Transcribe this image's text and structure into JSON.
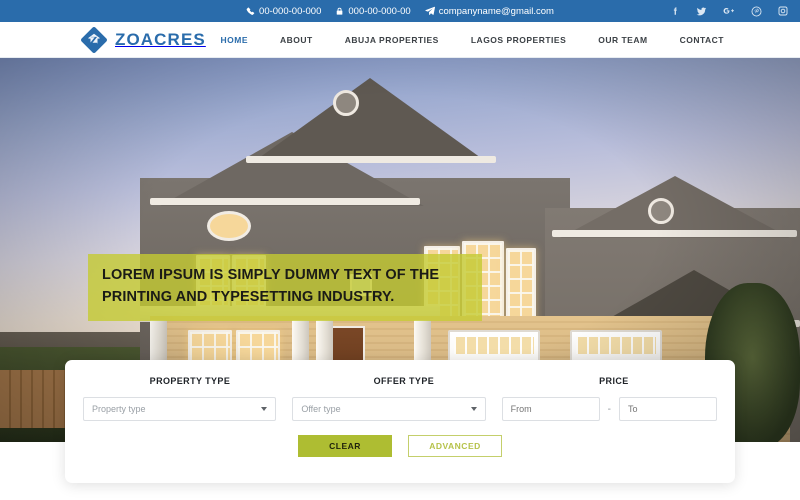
{
  "topbar": {
    "phone": "00-000-00-000",
    "fax": "000-00-000-00",
    "email": "companyname@gmail.com",
    "phone_icon": "phone-icon",
    "fax_icon": "lock-icon",
    "email_icon": "send-icon",
    "background_color": "#2a6cab",
    "social": [
      {
        "name": "facebook",
        "label": "f"
      },
      {
        "name": "twitter",
        "label": "t"
      },
      {
        "name": "google-plus",
        "label": "G+"
      },
      {
        "name": "pinterest",
        "label": "P"
      },
      {
        "name": "instagram",
        "label": "I"
      }
    ]
  },
  "header": {
    "brand": "ZOACRES",
    "brand_color": "#2a6cab",
    "nav": [
      {
        "label": "HOME",
        "active": true
      },
      {
        "label": "ABOUT",
        "active": false
      },
      {
        "label": "ABUJA PROPERTIES",
        "active": false
      },
      {
        "label": "LAGOS PROPERTIES",
        "active": false
      },
      {
        "label": "OUR TEAM",
        "active": false
      },
      {
        "label": "CONTACT",
        "active": false
      }
    ]
  },
  "hero": {
    "headline": "LOREM IPSUM IS SIMPLY DUMMY TEXT OF THE PRINTING AND TYPESETTING INDUSTRY.",
    "band_color": "#c4ca32",
    "image_description": "Two-story suburban house at dusk with lit windows, porch columns and two white garage doors"
  },
  "search": {
    "labels": {
      "property_type": "PROPERTY TYPE",
      "offer_type": "OFFER TYPE",
      "price": "PRICE"
    },
    "property_type_value": "Property type",
    "offer_type_value": "Offer type",
    "price_from_placeholder": "From",
    "price_to_placeholder": "To",
    "price_separator": "-",
    "clear_label": "CLEAR",
    "advanced_label": "ADVANCED",
    "clear_color": "#aebd32",
    "advanced_color": "#b6c24a"
  }
}
